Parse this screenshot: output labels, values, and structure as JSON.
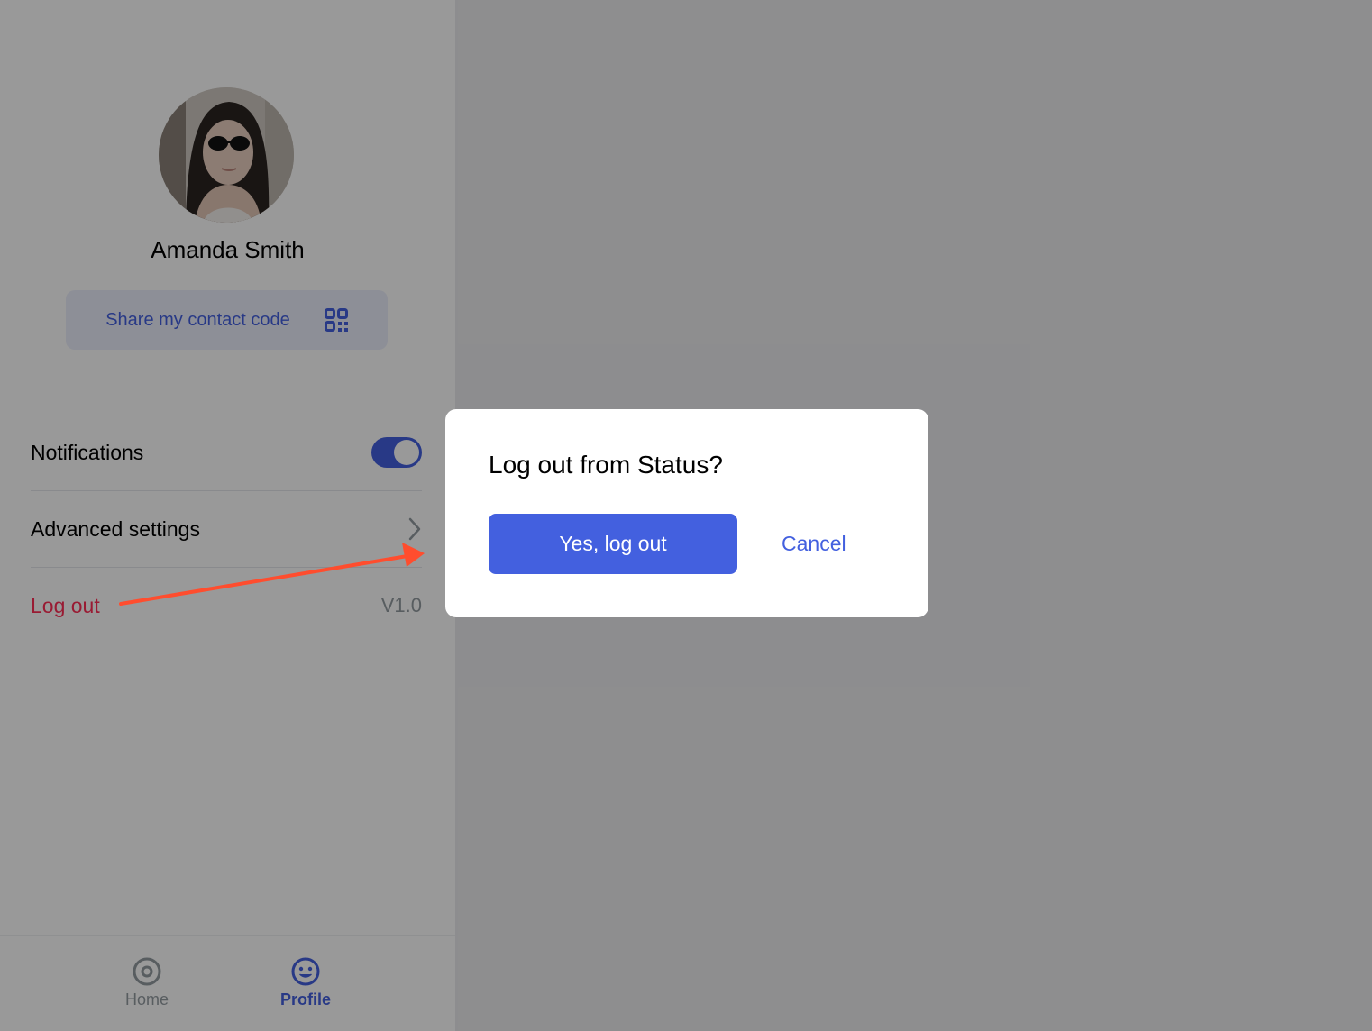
{
  "profile": {
    "name": "Amanda Smith",
    "avatar_icon": "user-photo",
    "share_label": "Share my contact code",
    "share_icon": "qr-code-icon"
  },
  "settings": {
    "notifications_label": "Notifications",
    "notifications_on": true,
    "advanced_label": "Advanced settings",
    "logout_label": "Log out",
    "version": "V1.0"
  },
  "tabbar": {
    "home_label": "Home",
    "profile_label": "Profile",
    "active": "Profile"
  },
  "dialog": {
    "title": "Log out from Status?",
    "confirm_label": "Yes, log out",
    "cancel_label": "Cancel"
  },
  "colors": {
    "accent": "#4360df",
    "danger": "#ff2d55",
    "annotation_arrow": "#ff4d2e",
    "overlay": "rgba(0,0,0,0.40)"
  }
}
